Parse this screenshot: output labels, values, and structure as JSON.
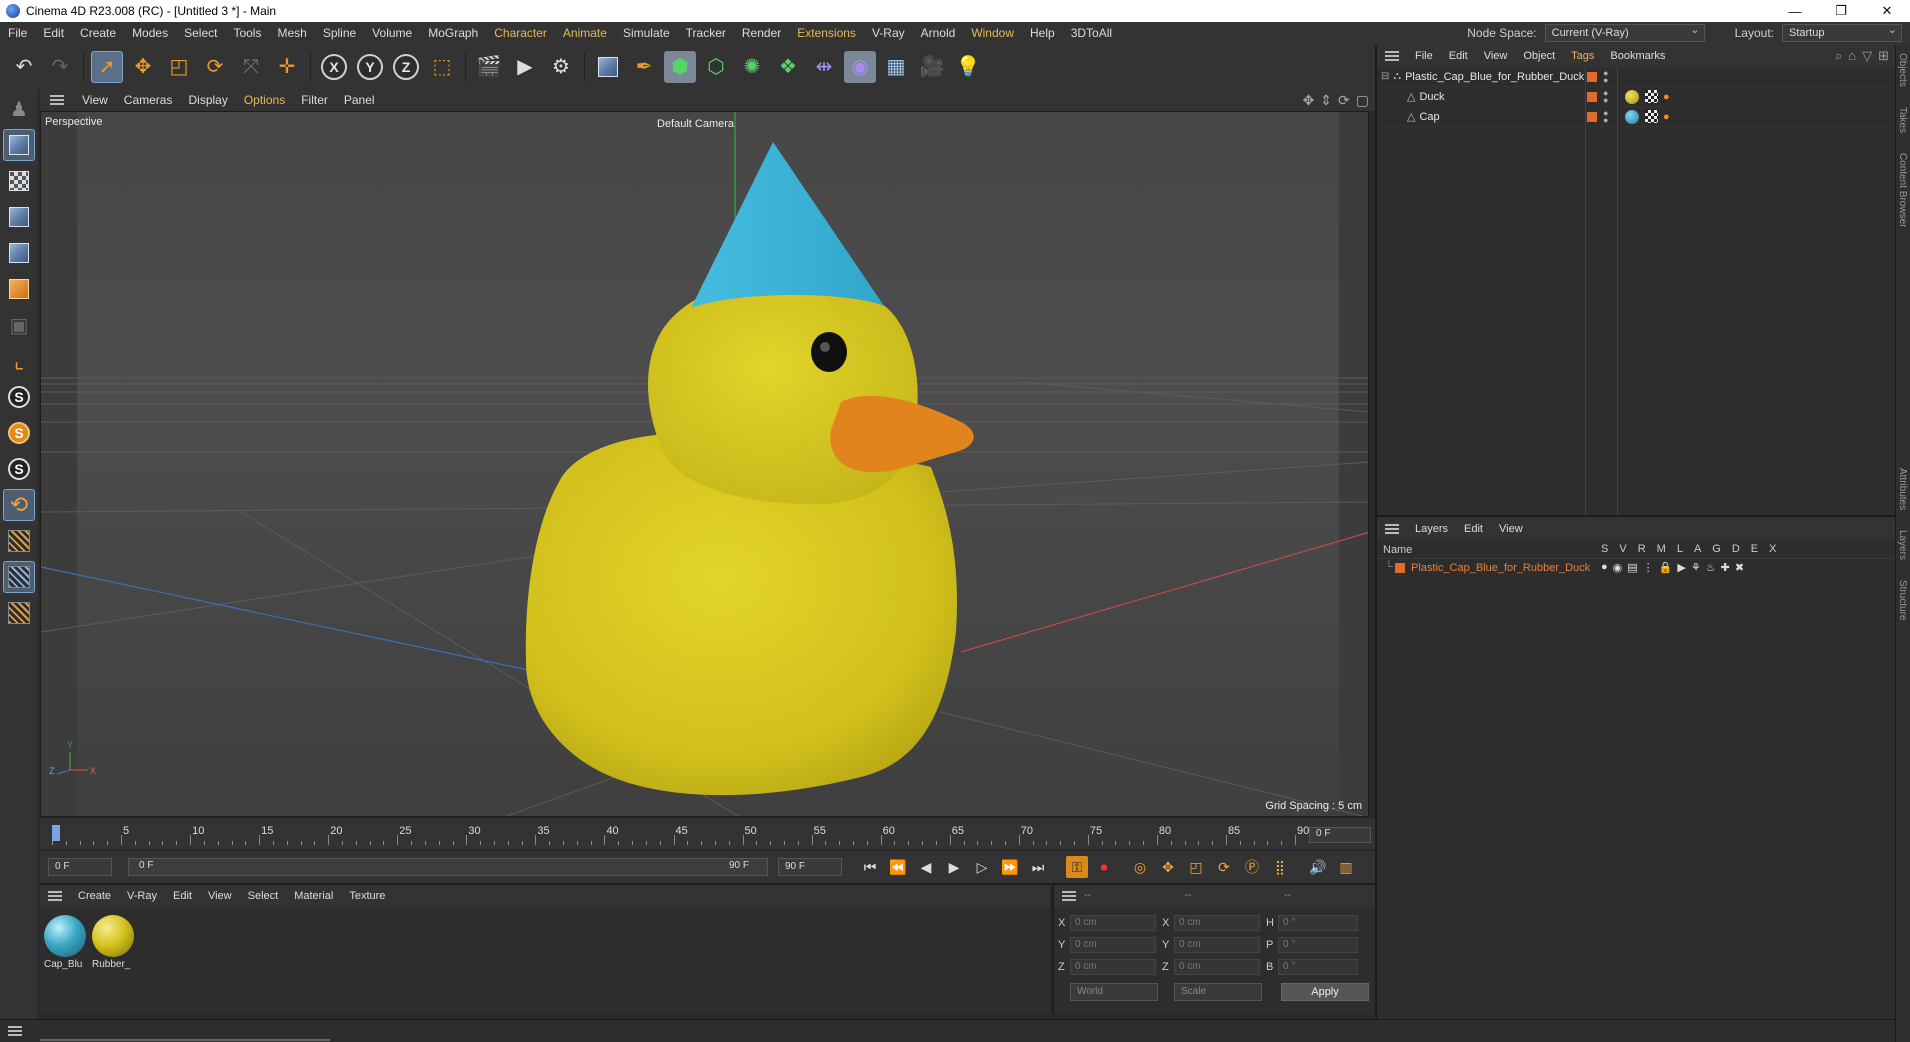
{
  "window": {
    "title": "Cinema 4D R23.008 (RC) - [Untitled 3 *] - Main",
    "controls": [
      "—",
      "❐",
      "✕"
    ]
  },
  "menubar": {
    "items": [
      "File",
      "Edit",
      "Create",
      "Modes",
      "Select",
      "Tools",
      "Mesh",
      "Spline",
      "Volume",
      "MoGraph",
      "Character",
      "Animate",
      "Simulate",
      "Tracker",
      "Render",
      "Extensions",
      "V-Ray",
      "Arnold",
      "Window",
      "Help",
      "3DToAll"
    ],
    "node_space_label": "Node Space:",
    "node_space_value": "Current (V-Ray)",
    "layout_label": "Layout:",
    "layout_value": "Startup"
  },
  "toolbar": {
    "axis_x": "X",
    "axis_y": "Y",
    "axis_z": "Z"
  },
  "lefttools": {
    "s1": "S",
    "s2": "S",
    "s3": "S"
  },
  "viewport": {
    "menu": [
      "View",
      "Cameras",
      "Display",
      "Options",
      "Filter",
      "Panel"
    ],
    "projection": "Perspective",
    "camera": "Default Camera",
    "grid_spacing": "Grid Spacing : 5 cm",
    "axis_labels": {
      "y": "Y",
      "z": "Z",
      "x": "X"
    }
  },
  "object_manager": {
    "menu": [
      "File",
      "Edit",
      "View",
      "Object",
      "Tags",
      "Bookmarks"
    ],
    "objects": [
      {
        "name": "Plastic_Cap_Blue_for_Rubber_Duck",
        "level": 0
      },
      {
        "name": "Duck",
        "level": 1
      },
      {
        "name": "Cap",
        "level": 1
      }
    ]
  },
  "layers": {
    "menu": [
      "Layers",
      "Edit",
      "View"
    ],
    "name_header": "Name",
    "columns": [
      "S",
      "V",
      "R",
      "M",
      "L",
      "A",
      "G",
      "D",
      "E",
      "X"
    ],
    "rows": [
      {
        "name": "Plastic_Cap_Blue_for_Rubber_Duck"
      }
    ]
  },
  "side_tabs": [
    "Objects",
    "Takes",
    "Content Browser",
    "Attributes",
    "Layers",
    "Structure"
  ],
  "timeline": {
    "ticks": [
      "0",
      "5",
      "10",
      "15",
      "20",
      "25",
      "30",
      "35",
      "40",
      "45",
      "50",
      "55",
      "60",
      "65",
      "70",
      "75",
      "80",
      "85",
      "90"
    ],
    "current_frame": "0 F"
  },
  "transport": {
    "start_frame": "0 F",
    "range_start": "0 F",
    "range_end": "90 F",
    "end_frame": "90 F"
  },
  "materials": {
    "menu": [
      "Create",
      "V-Ray",
      "Edit",
      "View",
      "Select",
      "Material",
      "Texture"
    ],
    "items": [
      {
        "name": "Cap_Blu",
        "color": "#3aa6c4"
      },
      {
        "name": "Rubber_",
        "color": "#d6c21c"
      }
    ]
  },
  "coordinates": {
    "header": [
      "--",
      "--",
      "--"
    ],
    "rows": [
      {
        "a1": "X",
        "v1": "0 cm",
        "a2": "X",
        "v2": "0 cm",
        "a3": "H",
        "v3": "0 °"
      },
      {
        "a1": "Y",
        "v1": "0 cm",
        "a2": "Y",
        "v2": "0 cm",
        "a3": "P",
        "v3": "0 °"
      },
      {
        "a1": "Z",
        "v1": "0 cm",
        "a2": "Z",
        "v2": "0 cm",
        "a3": "B",
        "v3": "0 °"
      }
    ],
    "space": "World",
    "mode": "Scale",
    "apply": "Apply"
  },
  "colors": {
    "accent_orange": "#e7b75b",
    "duck_yellow": "#d7c81f",
    "beak_orange": "#e2841d",
    "cap_blue": "#3fb5d8"
  }
}
